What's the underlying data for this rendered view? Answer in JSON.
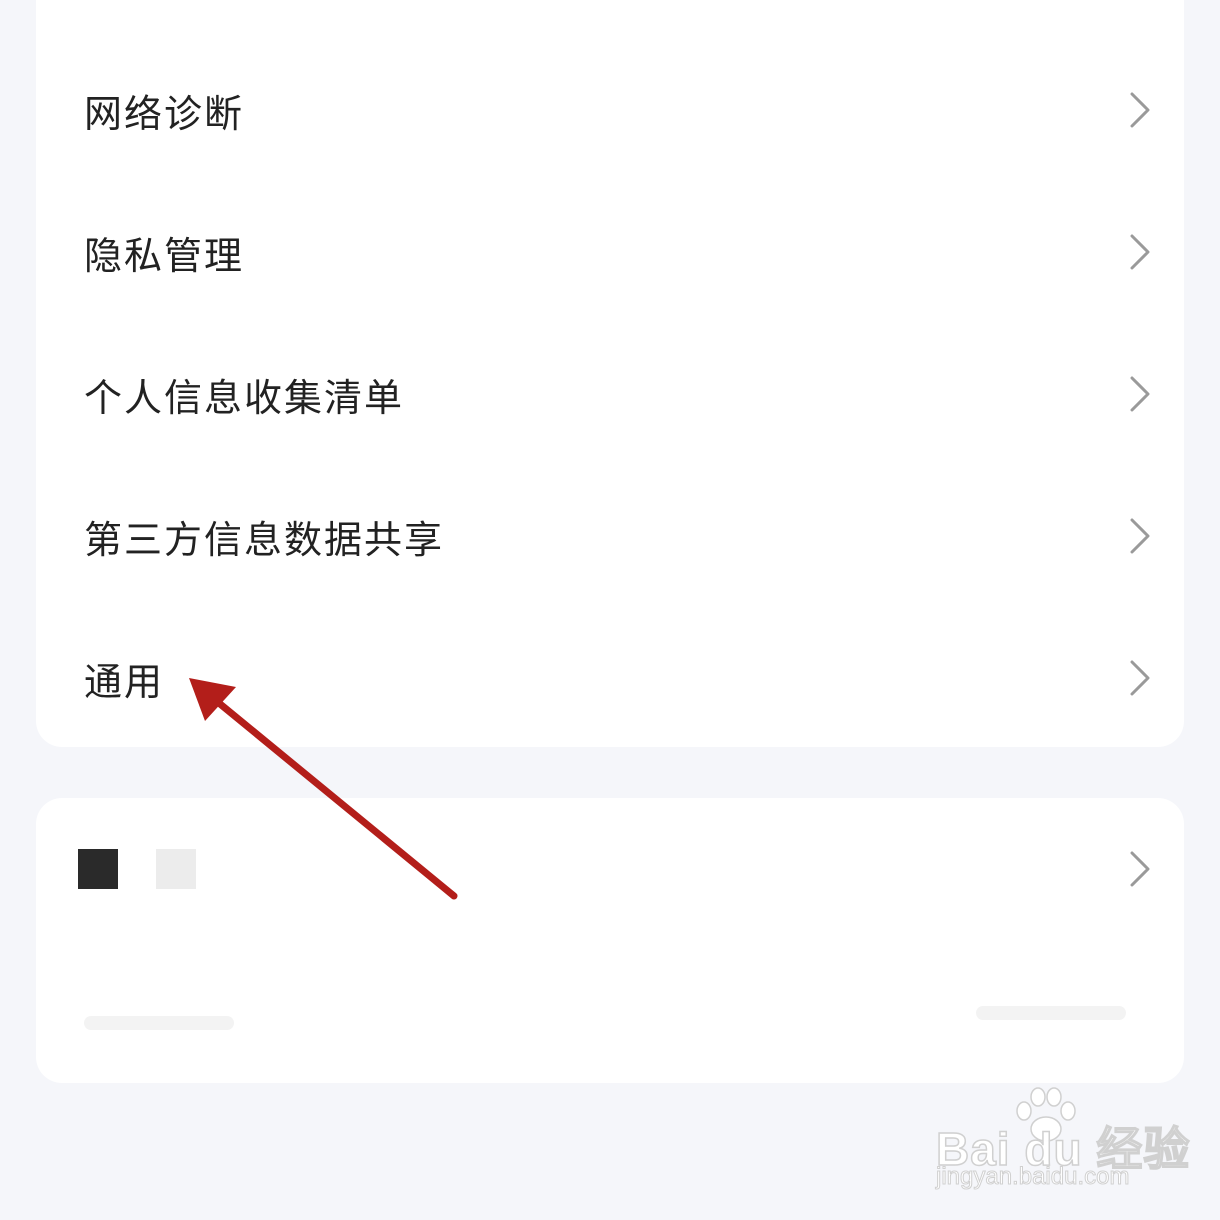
{
  "settings_list": {
    "items": [
      {
        "label": "网络诊断"
      },
      {
        "label": "隐私管理"
      },
      {
        "label": "个人信息收集清单"
      },
      {
        "label": "第三方信息数据共享"
      },
      {
        "label": "通用"
      }
    ]
  },
  "annotation": {
    "arrow_color": "#b31e1a"
  },
  "watermark": {
    "brand": "Bai du 经验",
    "url": "jingyan.baidu.com"
  },
  "colors": {
    "background": "#f5f6fa",
    "card": "#ffffff",
    "text": "#222222",
    "chevron": "#9a9a9a"
  }
}
